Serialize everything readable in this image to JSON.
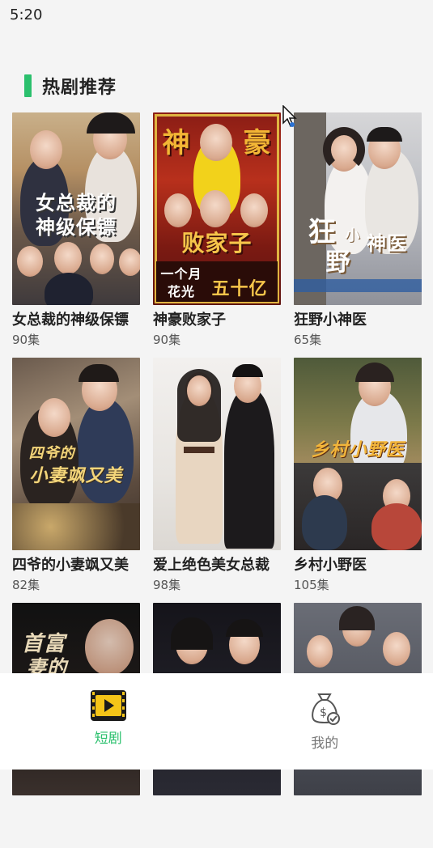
{
  "status": {
    "time": "5:20"
  },
  "section": {
    "title": "热剧推荐"
  },
  "dramas": [
    {
      "title": "女总裁的神级保镖",
      "episodes": "90集",
      "cover_lines": [
        "女总裁的",
        "神级保镖"
      ]
    },
    {
      "title": "神豪败家子",
      "episodes": "90集",
      "cover_lines": [
        "神",
        "豪",
        "败家子",
        "一个月",
        "花光",
        "五十亿"
      ]
    },
    {
      "title": "狂野小神医",
      "episodes": "65集",
      "cover_lines": [
        "狂",
        "小",
        "神医",
        "野"
      ]
    },
    {
      "title": "四爷的小妻飒又美",
      "episodes": "82集",
      "cover_lines": [
        "四爷的",
        "小妻飒又美"
      ]
    },
    {
      "title": "爱上绝色美女总裁",
      "episodes": "98集"
    },
    {
      "title": "乡村小野医",
      "episodes": "105集",
      "cover_lines": [
        "乡村小野医"
      ]
    }
  ],
  "partial_covers": [
    {
      "cover_lines": [
        "首富",
        "妻的"
      ]
    },
    {},
    {}
  ],
  "tabs": [
    {
      "label": "短剧",
      "icon": "film-icon",
      "active": true
    },
    {
      "label": "我的",
      "icon": "money-bag-icon",
      "active": false
    }
  ],
  "colors": {
    "accent": "#2bc06d",
    "background": "#f4f4f4",
    "inactive": "#777777"
  }
}
